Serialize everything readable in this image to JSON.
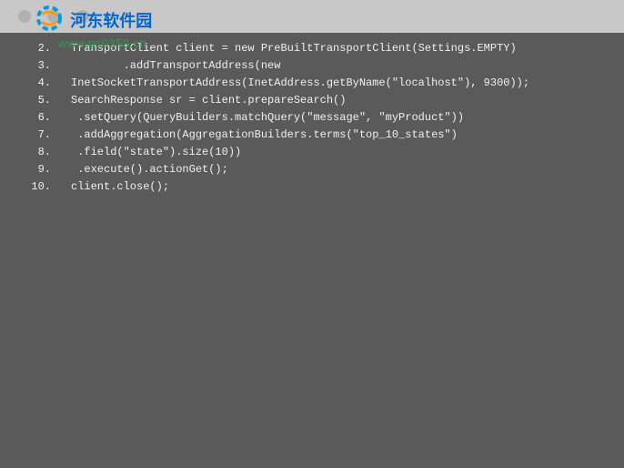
{
  "header": {
    "title": "河东软件园",
    "watermark": "www.pc0359.cn"
  },
  "code": {
    "lines": [
      "TransportClient client = new PreBuiltTransportClient(Settings.EMPTY)",
      "        .addTransportAddress(new",
      "InetSocketTransportAddress(InetAddress.getByName(\"localhost\"), 9300));",
      "",
      "SearchResponse sr = client.prepareSearch()",
      " .setQuery(QueryBuilders.matchQuery(\"message\", \"myProduct\"))",
      " .addAggregation(AggregationBuilders.terms(\"top_10_states\")",
      " .field(\"state\").size(10))",
      " .execute().actionGet();",
      "",
      "client.close();"
    ],
    "numberedVisualLines": [
      2,
      3,
      4,
      5,
      6,
      7,
      8,
      9,
      10
    ]
  }
}
